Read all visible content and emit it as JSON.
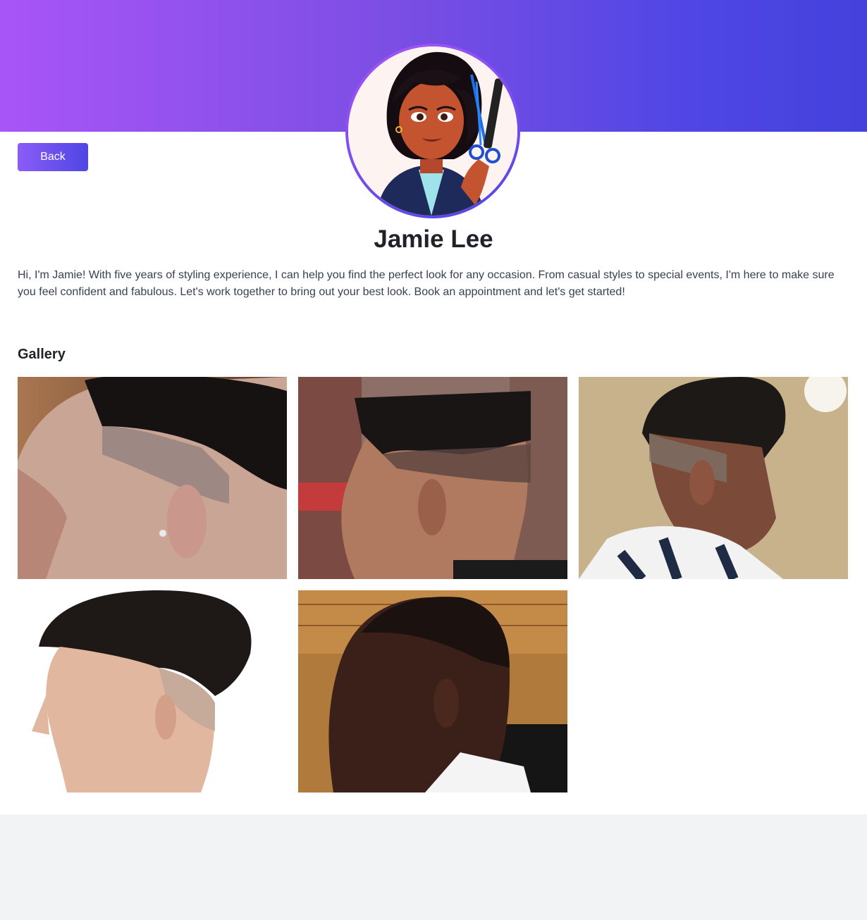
{
  "profile": {
    "back_label": "Back",
    "avatar_alt": "stylist-avatar",
    "name": "Jamie Lee",
    "bio": "Hi, I'm Jamie! With five years of styling experience, I can help you find the perfect look for any occasion. From casual styles to special events, I'm here to make sure you feel confident and fabulous. Let's work together to bring out your best look. Book an appointment and let's get started!"
  },
  "gallery": {
    "title": "Gallery",
    "items": [
      {
        "subject": "curly top fade, side profile"
      },
      {
        "subject": "flat top high fade, side profile"
      },
      {
        "subject": "curly top fade with design, side profile"
      },
      {
        "subject": "textured quiff with low fade, side profile"
      },
      {
        "subject": "short buzz fade, side profile"
      }
    ]
  },
  "colors": {
    "banner_start": "#a855f7",
    "banner_end": "#4441dc",
    "page_background": "#f2f3f5",
    "card_background": "#ffffff"
  }
}
